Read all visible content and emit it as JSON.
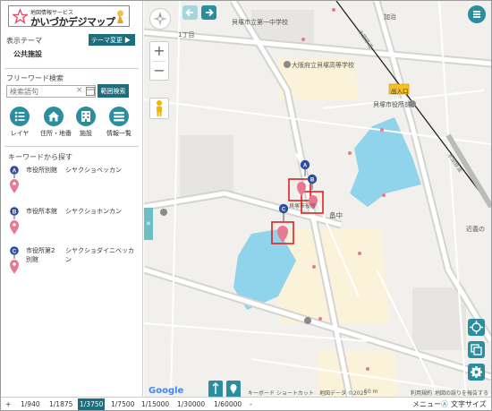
{
  "app": {
    "logo_small": "地図情報サービス",
    "logo_main": "かいづかデジマップ"
  },
  "sidebar": {
    "theme_label": "表示テーマ",
    "theme_button": "テーマ変更 ▶",
    "theme_value": "公共施設",
    "freeword_label": "フリーワード検索",
    "search_placeholder": "検索語句",
    "clear_icon": "×",
    "range_search_button": "範囲検索",
    "tools": [
      {
        "label": "レイヤ",
        "icon": "layer-list-icon"
      },
      {
        "label": "住所・地番",
        "icon": "house-icon"
      },
      {
        "label": "施設",
        "icon": "building-icon"
      },
      {
        "label": "情報一覧",
        "icon": "list-icon"
      }
    ],
    "keyword_label": "キーワードから探す",
    "keywords": [
      {
        "marker": "A",
        "name": "市役所別館",
        "reading": "シヤクショベッカン"
      },
      {
        "marker": "B",
        "name": "市役所本館",
        "reading": "シヤクショホンカン"
      },
      {
        "marker": "C",
        "name": "市役所第2別館",
        "reading": "シヤクショダイニベッカン"
      }
    ]
  },
  "scales": [
    {
      "label": "+",
      "active": false
    },
    {
      "label": "1/940",
      "active": false
    },
    {
      "label": "1/1875",
      "active": false
    },
    {
      "label": "1/3750",
      "active": true
    },
    {
      "label": "1/7500",
      "active": false
    },
    {
      "label": "1/15000",
      "active": false
    },
    {
      "label": "1/30000",
      "active": false
    },
    {
      "label": "1/60000",
      "active": false
    },
    {
      "label": "-",
      "active": false
    }
  ],
  "bottom_right": {
    "menu": "メニュー",
    "text_size": "文字サイズ"
  },
  "map": {
    "labels": {
      "school_junior": "貝塚市立第一中学校",
      "kaji": "加治",
      "chome": "1丁目",
      "high_school": "大阪府立貝塚高等学校",
      "station_exit": "出入口",
      "station": "貝塚市役所前",
      "hatanaka": "畠中",
      "kinki": "近義の",
      "line_name_1": "水間鉄道",
      "line_name_2": "水間鉄道",
      "city_hall_small": "貝塚市役所",
      "google": "Google",
      "shortcuts": "キーボード ショートカット",
      "map_data": "地図データ ©2025",
      "scale": "50 m",
      "terms": "利用規約",
      "report": "地図の誤りを報告する"
    },
    "markers": [
      "A",
      "B",
      "C"
    ],
    "colors": {
      "teal": "#2b8e9e",
      "water": "#8fd4ea",
      "marker_pink": "#e77a90",
      "marker_blue": "#2b4ea2",
      "highlight_red": "#e02020"
    }
  }
}
